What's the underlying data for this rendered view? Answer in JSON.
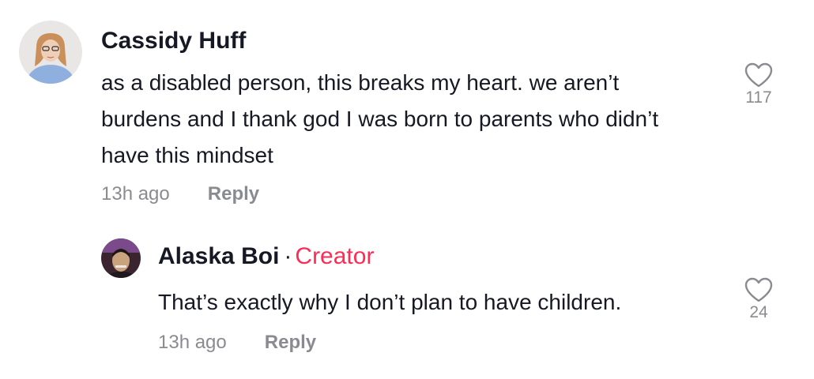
{
  "comments": [
    {
      "author": "Cassidy Huff",
      "text": "as a disabled person, this breaks my heart. we aren’t burdens and I thank god I was born to parents who didn’t have this mindset",
      "time": "13h ago",
      "reply_label": "Reply",
      "likes": "117",
      "like_icon": "heart-outline-icon"
    }
  ],
  "reply": {
    "author": "Alaska Boi",
    "separator": "·",
    "badge": "Creator",
    "text": "That’s exactly why I don’t plan to have children.",
    "time": "13h ago",
    "reply_label": "Reply",
    "likes": "24",
    "like_icon": "heart-outline-icon"
  },
  "colors": {
    "text": "#161823",
    "muted": "#8a8b91",
    "creator_badge": "#fe2c55"
  }
}
